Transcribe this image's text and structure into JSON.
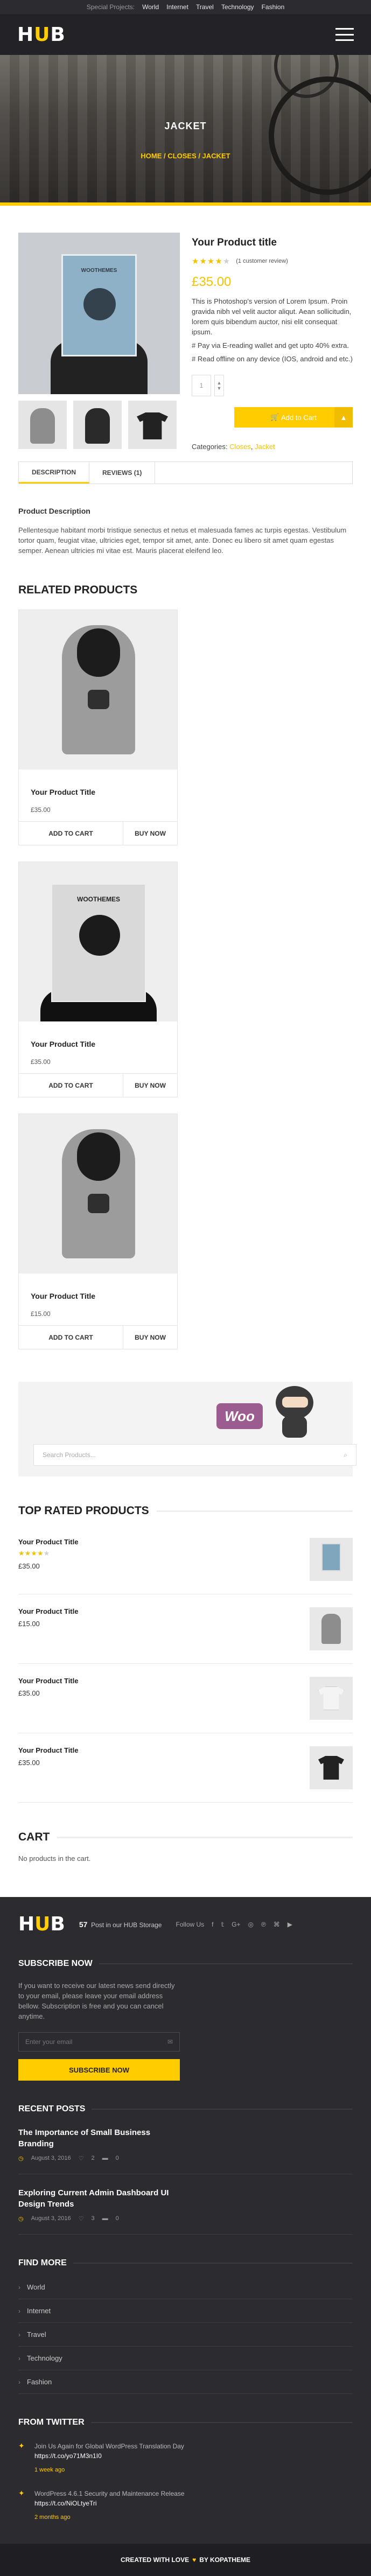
{
  "topbar": {
    "label": "Special Projects:",
    "links": [
      "World",
      "Internet",
      "Travel",
      "Technology",
      "Fashion"
    ]
  },
  "logo": {
    "part1": "H",
    "part2": "U",
    "part3": "B"
  },
  "hero": {
    "title": "JACKET",
    "breadcrumb": "HOME / CLOSES / JACKET"
  },
  "product": {
    "title": "Your Product title",
    "review_text": "(1 customer review)",
    "rating": 4,
    "rating_max": 5,
    "price": "£35.00",
    "description1": "This is Photoshop's version of Lorem Ipsum. Proin gravida nibh vel velit auctor aliqut. Aean sollicitudin, lorem quis bibendum auctor, nisi elit consequat ipsum.",
    "description2": "# Pay via E-reading wallet and get upto 40% extra.",
    "description3": "# Read offline on any device (IOS, android and etc.)",
    "qty_placeholder": "1",
    "add_to_cart": "Add to Cart",
    "categories_label": "Categories:",
    "categories": [
      "Closes",
      "Jacket"
    ],
    "poster_text": "WOOTHEMES"
  },
  "tabs": {
    "description": "DESCRIPTION",
    "reviews": "REVIEWS (1)"
  },
  "product_description": {
    "title": "Product Description",
    "text": "Pellentesque habitant morbi tristique senectus et netus et malesuada fames ac turpis egestas. Vestibulum tortor quam, feugiat vitae, ultricies eget, tempor sit amet, ante. Donec eu libero sit amet quam egestas semper. Aenean ultricies mi vitae est. Mauris placerat eleifend leo."
  },
  "related": {
    "heading": "RELATED PRODUCTS",
    "items": [
      {
        "name": "Your Product Title",
        "price": "£35.00",
        "add": "ADD TO CART",
        "buy": "BUY NOW"
      },
      {
        "name": "Your Product Title",
        "price": "£35.00",
        "add": "ADD TO CART",
        "buy": "BUY NOW"
      },
      {
        "name": "Your Product Title",
        "price": "£15.00",
        "add": "ADD TO CART",
        "buy": "BUY NOW"
      }
    ],
    "poster_text": "WOOTHEMES"
  },
  "search": {
    "placeholder": "Search Products...",
    "woo": "Woo"
  },
  "top_rated": {
    "heading": "TOP RATED PRODUCTS",
    "items": [
      {
        "name": "Your Product Title",
        "price": "£35.00",
        "rating": 4
      },
      {
        "name": "Your Product Title",
        "price": "£15.00"
      },
      {
        "name": "Your Product Title",
        "price": "£35.00"
      },
      {
        "name": "Your Product Title",
        "price": "£35.00"
      }
    ]
  },
  "cart": {
    "heading": "CART",
    "empty": "No products in the cart."
  },
  "footer": {
    "storage_count": "57",
    "storage_text": "Post in our HUB Storage",
    "follow": "Follow Us",
    "social": [
      "f",
      "𝕥",
      "G+",
      "◎",
      "℗",
      "⌘",
      "▶"
    ],
    "subscribe_heading": "SUBSCRIBE NOW",
    "subscribe_text": "If you want to receive our latest news send directly to your email, please leave your email address bellow. Subscription is free and you can cancel anytime.",
    "email_placeholder": "Enter your email",
    "subscribe_btn": "SUBSCRIBE NOW",
    "recent_heading": "RECENT POSTS",
    "posts": [
      {
        "title": "The Importance of Small Business Branding",
        "date": "August 3, 2016",
        "likes": "2",
        "comments": "0"
      },
      {
        "title": "Exploring Current Admin Dashboard UI Design Trends",
        "date": "August 3, 2016",
        "likes": "3",
        "comments": "0"
      }
    ],
    "find_heading": "FIND MORE",
    "find_items": [
      "World",
      "Internet",
      "Travel",
      "Technology",
      "Fashion"
    ],
    "twitter_heading": "FROM TWITTER",
    "tweets": [
      {
        "text": "Join Us Again for Global WordPress Translation Day ",
        "link": "https://t.co/yo71M3n1I0",
        "ago": "1 week ago"
      },
      {
        "text": "WordPress 4.6.1 Security and Maintenance Release ",
        "link": "https://t.co/NiOLtyeTri",
        "ago": "2 months ago"
      }
    ]
  },
  "bottom": {
    "prefix": "CREATED WITH LOVE",
    "heart": "♥",
    "suffix": "BY KOPATHEME"
  }
}
